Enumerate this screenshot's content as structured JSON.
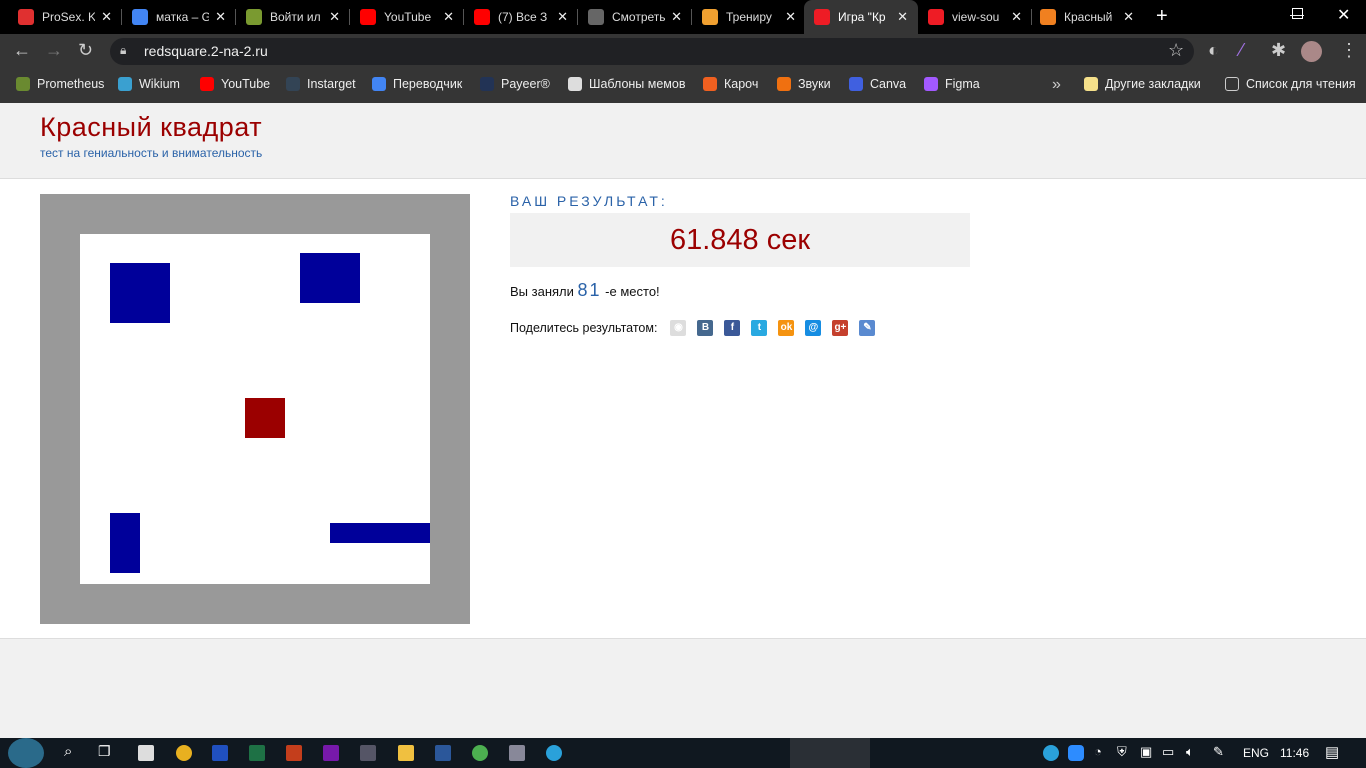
{
  "browser": {
    "tabs": [
      {
        "title": "ProSex. K",
        "color": "#e03030"
      },
      {
        "title": "матка – G",
        "color": "#4285f4"
      },
      {
        "title": "Войти ил",
        "color": "#7a9a30"
      },
      {
        "title": "YouTube",
        "color": "#ff0000"
      },
      {
        "title": "(7) Все З",
        "color": "#ff0000"
      },
      {
        "title": "Смотреть",
        "color": "#666666"
      },
      {
        "title": "Трениру",
        "color": "#f0a030"
      },
      {
        "title": "Игра \"Кр",
        "color": "#ee1c25"
      },
      {
        "title": "view-sou",
        "color": "#ee1c25"
      },
      {
        "title": "Красный",
        "color": "#f08020"
      }
    ],
    "active_tab": 7,
    "url": "redsquare.2-na-2.ru",
    "bookmarks": [
      {
        "label": "Prometheus",
        "color": "#6a8a30"
      },
      {
        "label": "Wikium",
        "color": "#3aa0d0"
      },
      {
        "label": "YouTube",
        "color": "#ff0000"
      },
      {
        "label": "Instarget",
        "color": "#334455"
      },
      {
        "label": "Переводчик",
        "color": "#4285f4"
      },
      {
        "label": "Payeer®",
        "color": "#223355"
      },
      {
        "label": "Шаблоны мемов",
        "color": "#dddddd"
      },
      {
        "label": "Кароч",
        "color": "#f06020"
      },
      {
        "label": "Звуки",
        "color": "#f07010"
      },
      {
        "label": "Canva",
        "color": "#4060e0"
      },
      {
        "label": "Figma",
        "color": "#a259ff"
      }
    ],
    "other_bookmarks": "Другие закладки",
    "reading_list": "Список для чтения"
  },
  "site": {
    "title": "Красный квадрат",
    "subtitle": "тест на гениальность и внимательность"
  },
  "result": {
    "label": "ВАШ РЕЗУЛЬТАТ:",
    "time": "61.848 сек",
    "place_prefix": "Вы заняли",
    "place": "81",
    "place_suffix": "-е место!",
    "share_label": "Поделитесь результатом:",
    "share": [
      {
        "name": "yaru",
        "glyph": "◉",
        "color": "#dddddd"
      },
      {
        "name": "vk",
        "glyph": "B",
        "color": "#45688e"
      },
      {
        "name": "facebook",
        "glyph": "f",
        "color": "#3b5998"
      },
      {
        "name": "twitter",
        "glyph": "t",
        "color": "#29a9e1"
      },
      {
        "name": "odnoklassniki",
        "glyph": "ok",
        "color": "#f59310"
      },
      {
        "name": "mailru",
        "glyph": "@",
        "color": "#168de2"
      },
      {
        "name": "googleplus",
        "glyph": "g+",
        "color": "#c5402d"
      },
      {
        "name": "livejournal",
        "glyph": "✎",
        "color": "#5a8ad0"
      }
    ]
  },
  "colors": {
    "red_square": "#9b0000",
    "blue_blocks": "#00009a",
    "board_border": "#999999"
  },
  "taskbar": {
    "lang": "ENG",
    "time": "11:46"
  }
}
